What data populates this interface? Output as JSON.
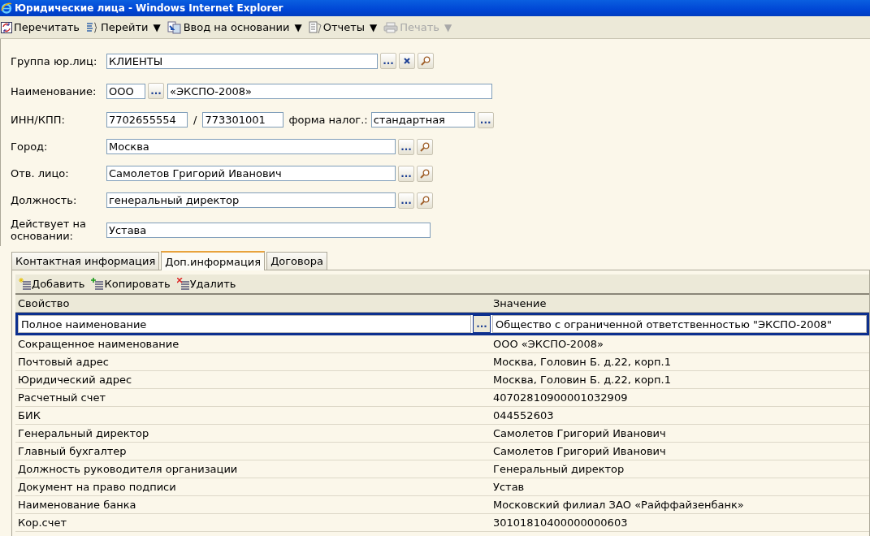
{
  "window": {
    "title": "Юридические лица - Windows Internet Explorer"
  },
  "toolbar": [
    {
      "kind": "reload",
      "label": "Перечитать",
      "disabled": false
    },
    {
      "kind": "goto",
      "label": "Перейти",
      "menu": "▼",
      "disabled": false
    },
    {
      "kind": "input",
      "label": "Ввод на основании",
      "menu": "▼",
      "disabled": false
    },
    {
      "kind": "reports",
      "label": "Отчеты",
      "menu": "▼",
      "disabled": false
    },
    {
      "kind": "print",
      "label": "Печать",
      "menu": "▼",
      "disabled": true
    }
  ],
  "form": [
    {
      "kind": "lookup",
      "label": "Группа юр.лиц:",
      "value": "КЛИЕНТЫ",
      "buttons": [
        {
          "kind": "choose",
          "text": "..."
        },
        {
          "kind": "clear"
        },
        {
          "kind": "open"
        }
      ]
    },
    {
      "kind": "name",
      "label": "Наименование:",
      "prefix": "ООО",
      "button": "...",
      "value": "«ЭКСПО-2008»"
    },
    {
      "kind": "inn",
      "label": "ИНН/КПП:",
      "inn": "7702655554",
      "separator": "/",
      "kpp": "773301001",
      "tax_label": "форма налог.:",
      "tax_value": "стандартная",
      "button": "..."
    },
    {
      "kind": "lookup",
      "label": "Город:",
      "value": "Москва",
      "buttons": [
        {
          "kind": "choose",
          "text": "..."
        },
        {
          "kind": "open"
        }
      ]
    },
    {
      "kind": "lookup",
      "label": "Отв. лицо:",
      "value": "Самолетов Григорий Иванович",
      "buttons": [
        {
          "kind": "choose",
          "text": "..."
        },
        {
          "kind": "open"
        }
      ]
    },
    {
      "kind": "lookup",
      "label": "Должность:",
      "value": "генеральный директор",
      "buttons": [
        {
          "kind": "choose",
          "text": "..."
        },
        {
          "kind": "open"
        }
      ]
    },
    {
      "kind": "lookup",
      "label": "Действует на основании:",
      "value": "Устава"
    }
  ],
  "tabs": [
    {
      "label": "Контактная информация",
      "selected": false
    },
    {
      "label": "Доп.информация",
      "selected": true
    },
    {
      "label": "Договора",
      "selected": false
    }
  ],
  "table_toolbar": [
    {
      "kind": "add",
      "label": "Добавить"
    },
    {
      "kind": "copy",
      "label": "Копировать"
    },
    {
      "kind": "delete",
      "label": "Удалить"
    }
  ],
  "table": {
    "columns": [
      "Свойство",
      "Значение"
    ],
    "edit_button": "...",
    "rows": [
      {
        "property": "Полное наименование",
        "value": "Общество с ограниченной ответственностью \"ЭКСПО-2008\"",
        "selected": true
      },
      {
        "property": "Сокращенное наименование",
        "value": "ООО «ЭКСПО-2008»",
        "selected": false
      },
      {
        "property": "Почтовый адрес",
        "value": "Москва, Головин Б. д.22, корп.1",
        "selected": false
      },
      {
        "property": "Юридический адрес",
        "value": "Москва, Головин Б. д.22, корп.1",
        "selected": false
      },
      {
        "property": "Расчетный счет",
        "value": "40702810900001032909",
        "selected": false
      },
      {
        "property": "БИК",
        "value": "044552603",
        "selected": false
      },
      {
        "property": "Генеральный директор",
        "value": "Самолетов Григорий Иванович",
        "selected": false
      },
      {
        "property": "Главный бухгалтер",
        "value": "Самолетов Григорий Иванович",
        "selected": false
      },
      {
        "property": "Должность руководителя организации",
        "value": "Генеральный директор",
        "selected": false
      },
      {
        "property": "Документ на право подписи",
        "value": "Устав",
        "selected": false
      },
      {
        "property": "Наименование банка",
        "value": "Московский филиал ЗАО «Райффайзенбанк»",
        "selected": false
      },
      {
        "property": "Кор.счет",
        "value": "30101810400000000603",
        "selected": false
      }
    ]
  }
}
